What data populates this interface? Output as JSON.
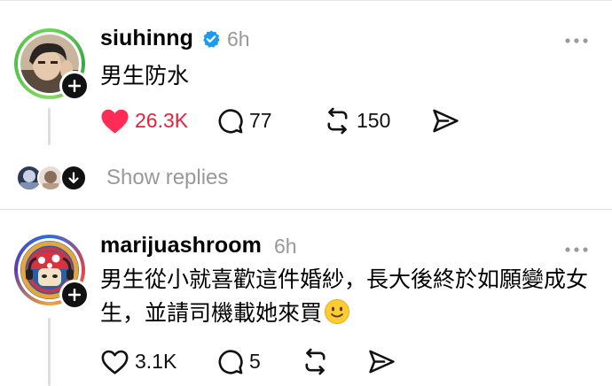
{
  "posts": [
    {
      "username": "siuhinng",
      "verified": true,
      "time": "6h",
      "text": "男生防水",
      "likes": "26.3K",
      "liked": true,
      "comments": "77",
      "reposts": "150",
      "show_replies": "Show replies"
    },
    {
      "username": "marijuashroom",
      "verified": false,
      "time": "6h",
      "text": "男生從小就喜歡這件婚紗，長大後終於如願變成女生，並請司機載她來買",
      "emoji": "slightly-smiling-face",
      "likes": "3.1K",
      "liked": false,
      "comments": "5",
      "reposts": ""
    }
  ],
  "colors": {
    "like_red": "#e0243e",
    "verified_blue": "#1d9bf0",
    "secondary_gray": "#999999"
  }
}
